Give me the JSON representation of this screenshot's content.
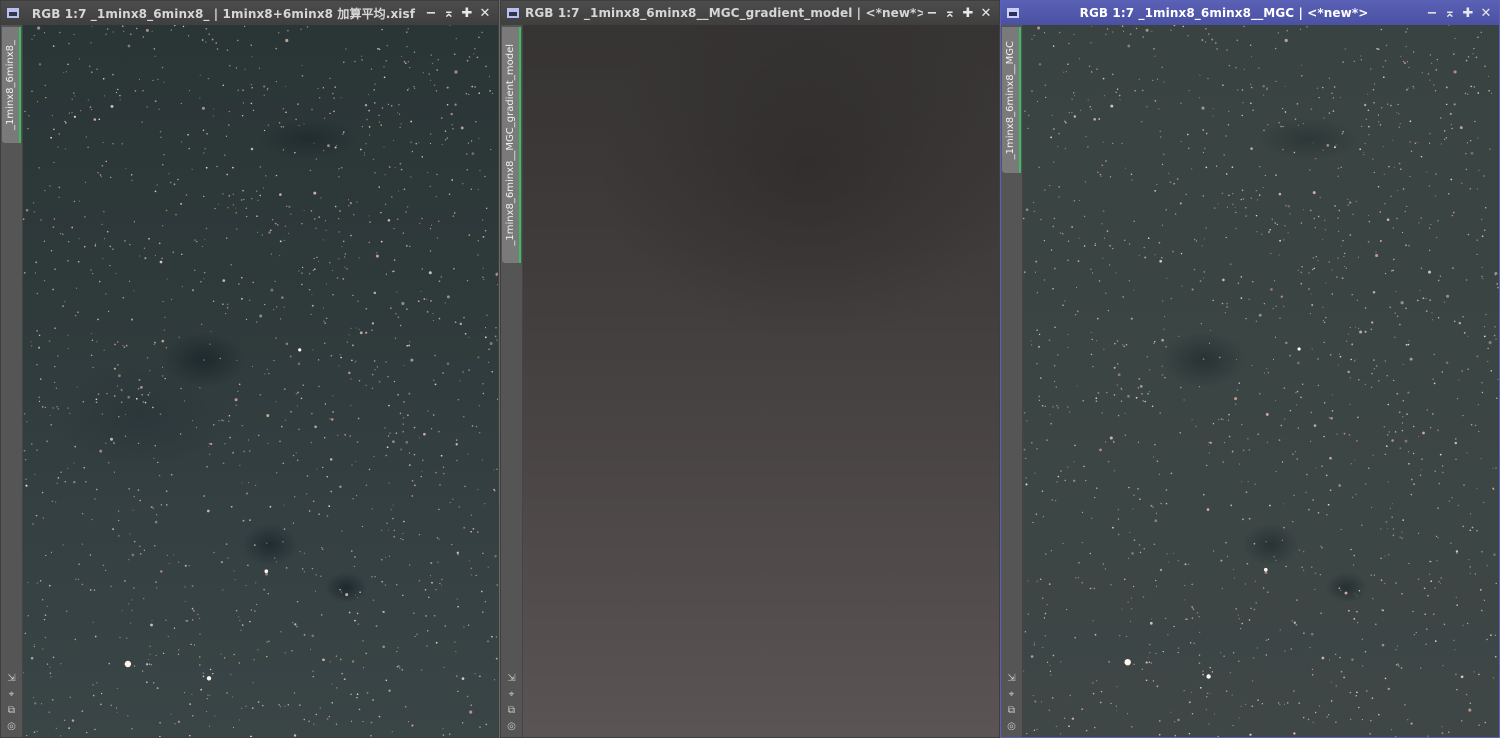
{
  "windows": [
    {
      "id": "w1",
      "title": "RGB 1:7 _1minx8_6minx8_ | 1minx8+6minx8 加算平均.xisf",
      "tab_label": "_1minx8_6minx8_",
      "active": false
    },
    {
      "id": "w2",
      "title": "RGB 1:7 _1minx8_6minx8__MGC_gradient_model | <*new*>",
      "tab_label": "_1minx8_6minx8__MGC_gradient_model",
      "active": false
    },
    {
      "id": "w3",
      "title": "RGB 1:7 _1minx8_6minx8__MGC | <*new*>",
      "tab_label": "_1minx8_6minx8__MGC",
      "active": true
    }
  ],
  "controls": {
    "minimize_icon": "minimize-icon",
    "shade_icon": "shade-icon",
    "maximize_icon": "maximize-icon",
    "close_icon": "close-icon",
    "minimize": "−",
    "shade": "⌅",
    "maximize": "✚",
    "close": "✕"
  },
  "side_tools": {
    "fit": "⇲",
    "zoom": "⌖",
    "clone": "⧉",
    "target": "◎"
  },
  "colors": {
    "active_title": "#5a60b4",
    "inactive_title": "#444444",
    "tab_accent": "#38c060"
  }
}
